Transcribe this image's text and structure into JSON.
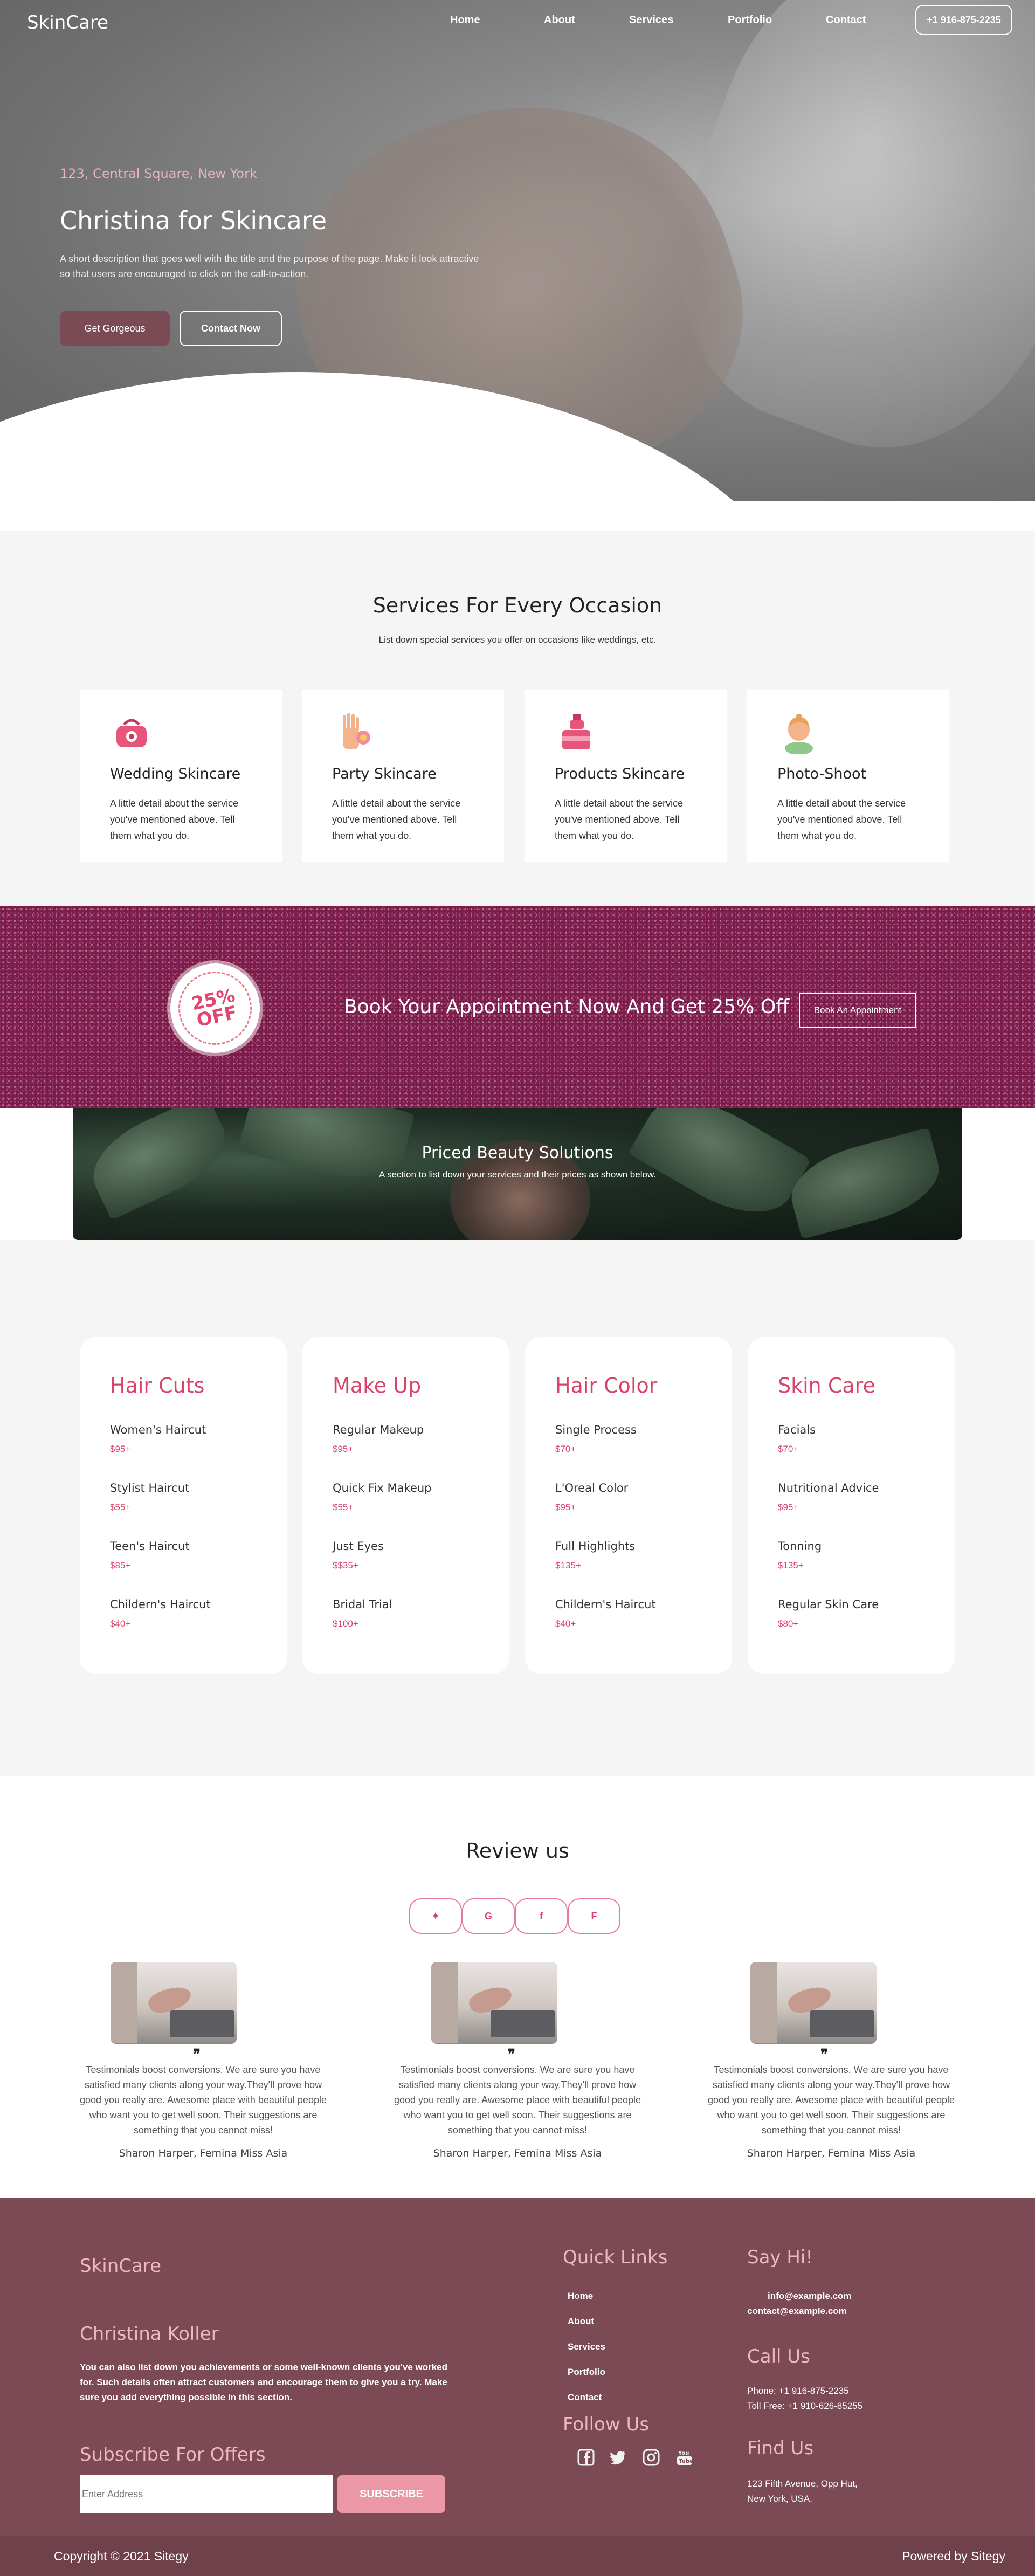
{
  "nav": {
    "brand": "SkinCare",
    "links": [
      "Home",
      "About",
      "Services",
      "Portfolio",
      "Contact"
    ],
    "phone": "+1 916-875-2235"
  },
  "hero": {
    "address": "123, Central Square, New York",
    "title": "Christina for Skincare",
    "description": "A short description that goes well with the title and the purpose of the page. Make it look attractive so that users are encouraged to click on the call-to-action.",
    "primary_button": "Get Gorgeous",
    "secondary_button": "Contact Now"
  },
  "services": {
    "title": "Services For Every Occasion",
    "subtitle": "List down special services you offer on occasions like weddings, etc.",
    "cards": [
      {
        "title": "Wedding Skincare",
        "text": "A little detail about the service you've mentioned above. Tell them what you do.",
        "icon": "makeup-bag-icon"
      },
      {
        "title": "Party Skincare",
        "text": "A little detail about the service you've mentioned above. Tell them what you do.",
        "icon": "hand-polish-icon"
      },
      {
        "title": "Products Skincare",
        "text": "A little detail about the service you've mentioned above. Tell them what you do.",
        "icon": "product-bottles-icon"
      },
      {
        "title": "Photo-Shoot",
        "text": "A little detail about the service you've mentioned above. Tell them what you do.",
        "icon": "woman-face-icon"
      }
    ]
  },
  "promo": {
    "badge_line1": "25%",
    "badge_line2": "OFF",
    "text": "Book Your Appointment Now And Get 25% Off",
    "button": "Book An Appointment"
  },
  "priced": {
    "title": "Priced Beauty Solutions",
    "subtitle": "A section to list down your services and their prices as shown below."
  },
  "pricing": [
    {
      "title": "Hair Cuts",
      "items": [
        {
          "name": "Women's Haircut",
          "price": "$95+"
        },
        {
          "name": "Stylist Haircut",
          "price": "$55+"
        },
        {
          "name": "Teen's Haircut",
          "price": "$85+"
        },
        {
          "name": "Childern's Haircut",
          "price": "$40+"
        }
      ]
    },
    {
      "title": "Make Up",
      "items": [
        {
          "name": "Regular Makeup",
          "price": "$95+"
        },
        {
          "name": "Quick Fix Makeup",
          "price": "$55+"
        },
        {
          "name": "Just Eyes",
          "price": "$$35+"
        },
        {
          "name": "Bridal Trial",
          "price": "$100+"
        }
      ]
    },
    {
      "title": "Hair Color",
      "items": [
        {
          "name": "Single Process",
          "price": "$70+"
        },
        {
          "name": "L'Oreal Color",
          "price": "$95+"
        },
        {
          "name": "Full Highlights",
          "price": "$135+"
        },
        {
          "name": "Childern's Haircut",
          "price": "$40+"
        }
      ]
    },
    {
      "title": "Skin Care",
      "items": [
        {
          "name": "Facials",
          "price": "$70+"
        },
        {
          "name": "Nutritional Advice",
          "price": "$95+"
        },
        {
          "name": "Tonning",
          "price": "$135+"
        },
        {
          "name": "Regular Skin Care",
          "price": "$80+"
        }
      ]
    }
  ],
  "review": {
    "title": "Review us",
    "social": [
      "yelp-icon",
      "google-icon",
      "facebook-icon",
      "foursquare-icon"
    ],
    "social_glyphs": [
      "✦",
      "G",
      "f",
      "F"
    ],
    "items": [
      {
        "text": "Testimonials boost conversions. We are sure you have satisfied many clients along your way.They'll prove how good you really are. Awesome place with beautiful people who want you to get well soon. Their suggestions are something that you cannot miss!",
        "name": "Sharon Harper, Femina Miss Asia"
      },
      {
        "text": "Testimonials boost conversions. We are sure you have satisfied many clients along your way.They'll prove how good you really are. Awesome place with beautiful people who want you to get well soon. Their suggestions are something that you cannot miss!",
        "name": "Sharon Harper, Femina Miss Asia"
      },
      {
        "text": "Testimonials boost conversions. We are sure you have satisfied many clients along your way.They'll prove how good you really are. Awesome place with beautiful people who want you to get well soon. Their suggestions are something that you cannot miss!",
        "name": "Sharon Harper, Femina Miss Asia"
      }
    ]
  },
  "footer": {
    "brand": "SkinCare",
    "owner": "Christina Koller",
    "owner_text": "You can also list down you achievements or some well-known clients you've worked for. Such details often attract customers and encourage them to give you a try. Make sure you add everything possible in this section.",
    "subscribe_title": "Subscribe For Offers",
    "email_placeholder": "Enter Address",
    "subscribe_button": "SUBSCRIBE",
    "quick_links_title": "Quick Links",
    "quick_links": [
      "Home",
      "About",
      "Services",
      "Portfolio",
      "Contact"
    ],
    "follow_title": "Follow Us",
    "follow_icons": [
      "facebook-square-icon",
      "twitter-icon",
      "instagram-icon",
      "youtube-icon"
    ],
    "say_hi_title": "Say Hi!",
    "email1": "info@example.com",
    "email2": "contact@example.com",
    "call_title": "Call Us",
    "phone": "Phone: +1 916-875-2235",
    "toll_free": "Toll Free: +1 910-626-85255",
    "find_title": "Find Us",
    "address_line1": "123 Fifth Avenue, Opp Hut,",
    "address_line2": "New York, USA."
  },
  "bottombar": {
    "copyright": "Copyright © 2021 Sitegy",
    "powered": "Powered by Sitegy"
  },
  "colors": {
    "accent_pink": "#d9436b",
    "footer_bg": "#7b4a55",
    "promo_bg": "#7b1d4b"
  }
}
